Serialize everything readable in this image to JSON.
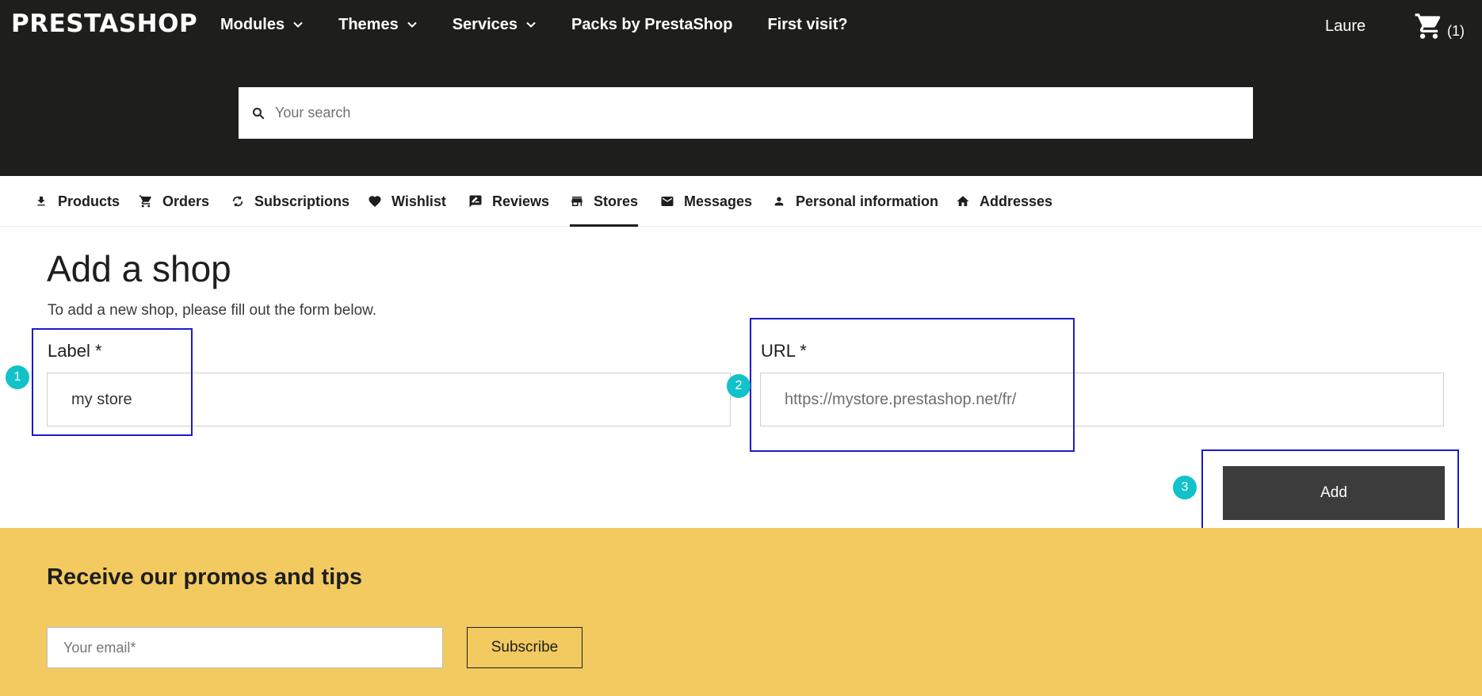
{
  "header": {
    "logo": "PRESTASHOP",
    "nav": [
      {
        "label": "Modules",
        "dropdown": true
      },
      {
        "label": "Themes",
        "dropdown": true
      },
      {
        "label": "Services",
        "dropdown": true
      },
      {
        "label": "Packs by PrestaShop",
        "dropdown": false
      },
      {
        "label": "First visit?",
        "dropdown": false
      }
    ],
    "user_name": "Laure",
    "cart_count": "(1)",
    "search_placeholder": "Your search"
  },
  "tabs": [
    {
      "label": "Products",
      "icon": "download-icon",
      "active": false
    },
    {
      "label": "Orders",
      "icon": "cart-icon",
      "active": false
    },
    {
      "label": "Subscriptions",
      "icon": "refresh-icon",
      "active": false
    },
    {
      "label": "Wishlist",
      "icon": "heart-icon",
      "active": false
    },
    {
      "label": "Reviews",
      "icon": "review-icon",
      "active": false
    },
    {
      "label": "Stores",
      "icon": "store-icon",
      "active": true
    },
    {
      "label": "Messages",
      "icon": "mail-icon",
      "active": false
    },
    {
      "label": "Personal information",
      "icon": "person-icon",
      "active": false
    },
    {
      "label": "Addresses",
      "icon": "home-icon",
      "active": false
    }
  ],
  "form": {
    "title": "Add a shop",
    "subtitle": "To add a new shop, please fill out the form below.",
    "label_field": {
      "label": "Label *",
      "value": "my store"
    },
    "url_field": {
      "label": "URL *",
      "placeholder": "https://mystore.prestashop.net/fr/"
    },
    "submit_label": "Add"
  },
  "annotations": [
    "1",
    "2",
    "3"
  ],
  "newsletter": {
    "title": "Receive our promos and tips",
    "email_placeholder": "Your email*",
    "subscribe_label": "Subscribe"
  },
  "colors": {
    "header_bg": "#1e1e1c",
    "promo_bg": "#f2ca60",
    "button_bg": "#3c3c3c",
    "annotation_box": "#1c1cc4",
    "annotation_badge": "#11c2c8"
  }
}
